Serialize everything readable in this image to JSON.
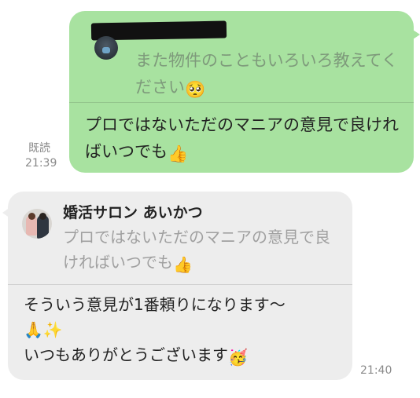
{
  "outgoing": {
    "quote_text": "また物件のこともいろいろ教えてください",
    "quote_emoji": "🥺",
    "body_text": "プロではないただのマニアの意見で良ければいつでも",
    "body_emoji": "👍",
    "read_label": "既読",
    "time": "21:39"
  },
  "incoming": {
    "sender_name": "婚活サロン あいかつ",
    "quote_text": "プロではないただのマニアの意見で良ければいつでも",
    "quote_emoji": "👍",
    "line1": "そういう意見が1番頼りになります〜",
    "line2_emoji": "🙏✨",
    "line3": "いつもありがとうございます",
    "line3_emoji": "🥳",
    "time": "21:40"
  },
  "colors": {
    "outgoing_bubble": "#a8e2a0",
    "incoming_bubble": "#ededed",
    "meta_text": "#8a8a8a"
  }
}
